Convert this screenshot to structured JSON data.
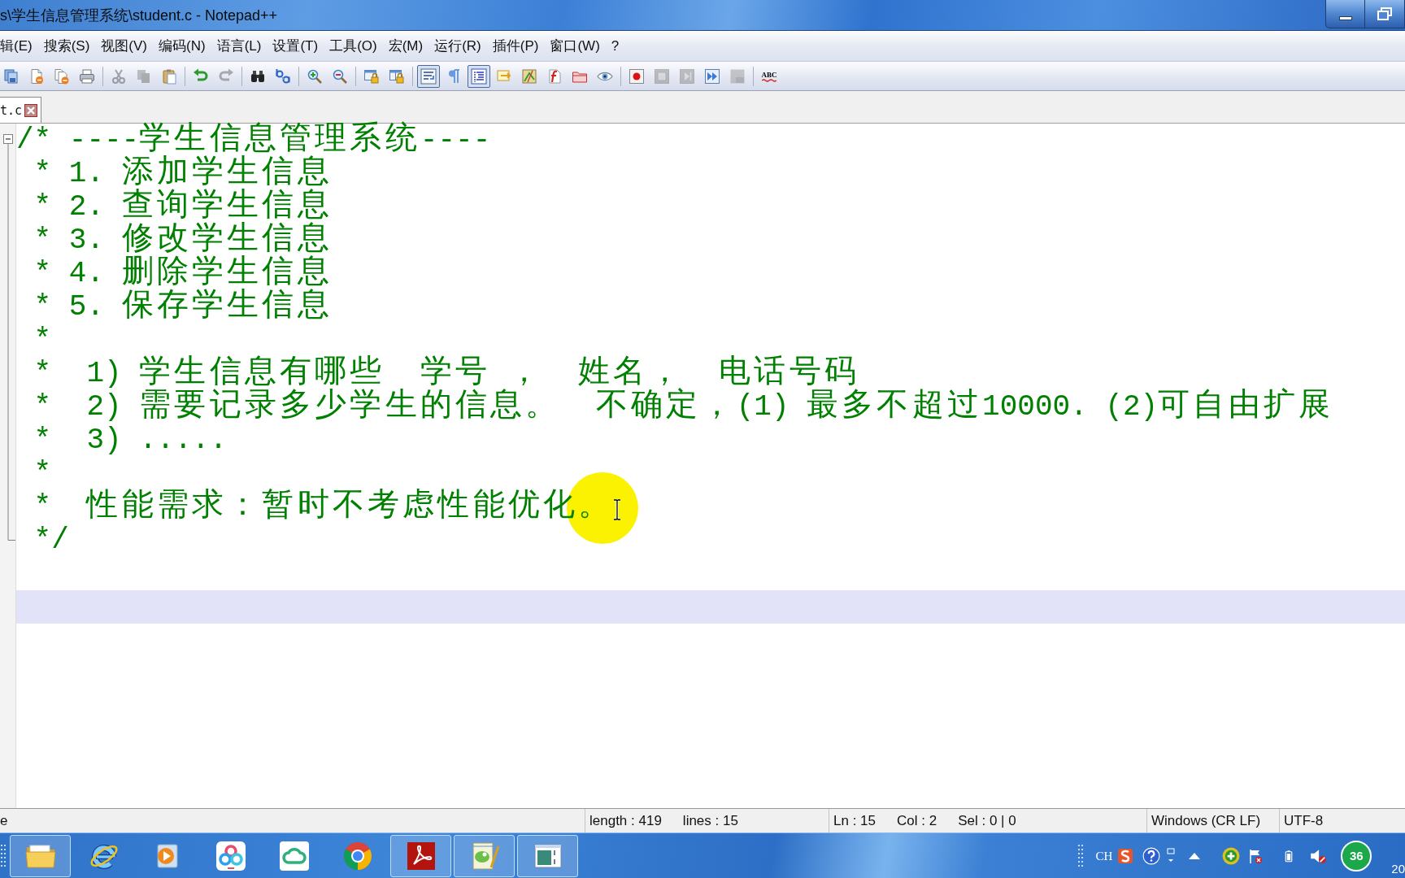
{
  "window": {
    "title": "s\\学生信息管理系统\\student.c - Notepad++"
  },
  "menu": [
    "辑(E)",
    "搜索(S)",
    "视图(V)",
    "编码(N)",
    "语言(L)",
    "设置(T)",
    "工具(O)",
    "宏(M)",
    "运行(R)",
    "插件(P)",
    "窗口(W)",
    "?"
  ],
  "toolbar": [
    {
      "disabled": false,
      "pressed": false
    },
    {
      "disabled": false,
      "pressed": false
    },
    {
      "disabled": false,
      "pressed": false
    },
    {
      "disabled": false,
      "pressed": false
    },
    {
      "disabled": true,
      "pressed": false
    },
    {
      "disabled": true,
      "pressed": false
    },
    {
      "disabled": false,
      "pressed": false
    },
    {
      "disabled": false,
      "pressed": false
    },
    {
      "disabled": true,
      "pressed": false
    },
    {
      "disabled": false,
      "pressed": false
    },
    {
      "disabled": false,
      "pressed": false
    },
    {
      "disabled": false,
      "pressed": false
    },
    {
      "disabled": false,
      "pressed": false
    },
    {
      "disabled": false,
      "pressed": false
    },
    {
      "disabled": false,
      "pressed": false
    },
    {
      "disabled": false,
      "pressed": true
    },
    {
      "disabled": false,
      "pressed": false
    },
    {
      "disabled": false,
      "pressed": true
    },
    {
      "disabled": false,
      "pressed": false
    },
    {
      "disabled": false,
      "pressed": false
    },
    {
      "disabled": false,
      "pressed": false
    },
    {
      "disabled": false,
      "pressed": false
    },
    {
      "disabled": false,
      "pressed": false
    },
    {
      "disabled": false,
      "pressed": false
    },
    {
      "disabled": true,
      "pressed": false
    },
    {
      "disabled": true,
      "pressed": false
    },
    {
      "disabled": false,
      "pressed": false
    },
    {
      "disabled": true,
      "pressed": false
    }
  ],
  "spellcheck": {
    "label": "ABC"
  },
  "tabs": [
    {
      "label": "t.c",
      "selected": true
    }
  ],
  "editor": {
    "fold": {
      "expanded": true
    },
    "lines": [
      {
        "text": "/* ----学生信息管理系统----",
        "current": false
      },
      {
        "text": " * 1. 添加学生信息",
        "current": false
      },
      {
        "text": " * 2. 查询学生信息",
        "current": false
      },
      {
        "text": " * 3. 修改学生信息",
        "current": false
      },
      {
        "text": " * 4. 删除学生信息",
        "current": false
      },
      {
        "text": " * 5. 保存学生信息",
        "current": false
      },
      {
        "text": " *",
        "current": false
      },
      {
        "text": " *  1) 学生信息有哪些  学号 ，  姓名，  电话号码",
        "current": false
      },
      {
        "text": " *  2) 需要记录多少学生的信息。  不确定，(1) 最多不超过10000. (2)可自由扩展",
        "current": false
      },
      {
        "text": " *  3) .....",
        "current": false
      },
      {
        "text": " *",
        "current": false
      },
      {
        "text": " *  性能需求：暂时不考虑性能优化。",
        "current": false
      },
      {
        "text": " */",
        "current": false
      },
      {
        "current": false
      },
      {
        "current": true
      }
    ]
  },
  "status_bar": {
    "panels": [
      {
        "items": [
          "e"
        ]
      },
      {
        "items": [
          "length : 419",
          "lines : 15"
        ]
      },
      {
        "items": [
          "Ln : 15",
          "Col : 2",
          "Sel : 0 | 0"
        ]
      },
      {
        "items": [
          "Windows (CR LF)"
        ]
      },
      {
        "items": [
          "UTF-8"
        ]
      }
    ]
  },
  "taskbar": {
    "apps": [
      {
        "running": true
      },
      {
        "running": false
      },
      {
        "running": false
      },
      {
        "running": false
      },
      {
        "running": false
      },
      {
        "running": false
      },
      {
        "running": true
      },
      {
        "running": true
      },
      {
        "running": true
      }
    ],
    "tray": {
      "language": "CH",
      "badge": "36",
      "clock": "20"
    }
  }
}
